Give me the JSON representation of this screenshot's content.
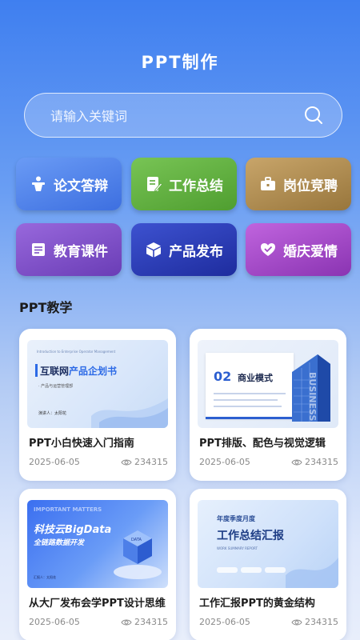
{
  "header": {
    "title": "PPT制作"
  },
  "search": {
    "placeholder": "请输入关键词"
  },
  "categories": [
    {
      "label": "论文答辩",
      "icon": "podium-icon",
      "color": "#4a7ee8"
    },
    {
      "label": "工作总结",
      "icon": "note-edit-icon",
      "color": "#5aaa3a"
    },
    {
      "label": "岗位竞聘",
      "icon": "briefcase-icon",
      "color": "#a8864a"
    },
    {
      "label": "教育课件",
      "icon": "book-icon",
      "color": "#7b4fc4"
    },
    {
      "label": "产品发布",
      "icon": "box-icon",
      "color": "#2f3fb8"
    },
    {
      "label": "婚庆爱情",
      "icon": "heart-icon",
      "color": "#a24ac4"
    }
  ],
  "section": {
    "title": "PPT教学"
  },
  "cards": [
    {
      "title": "PPT小白快速入门指南",
      "date": "2025-06-05",
      "views": "234315",
      "thumb": {
        "line1": "Introduction to Enterprise Operator Management",
        "heading_a": "互联网",
        "heading_b": "产品企划书",
        "sub": "· 产品与运营管理部",
        "presenter": "演讲人：太阳花"
      }
    },
    {
      "title": "PPT排版、配色与视觉逻辑",
      "date": "2025-06-05",
      "views": "234315",
      "thumb": {
        "number": "02",
        "heading": "商业模式",
        "watermark": "BUSINESS"
      }
    },
    {
      "title": "从大厂发布会学PPT设计思维",
      "date": "2025-06-05",
      "views": "234315",
      "thumb": {
        "top": "IMPORTANT MATTERS",
        "heading": "科技云BigData",
        "sub": "全链路数据开发",
        "reporter": "汇报人：太阳花"
      }
    },
    {
      "title": "工作汇报PPT的黄金结构",
      "date": "2025-06-05",
      "views": "234315",
      "thumb": {
        "top": "年度季度月度",
        "heading": "工作总结汇报",
        "sub": "WORK SUMMARY REPORT"
      }
    }
  ]
}
